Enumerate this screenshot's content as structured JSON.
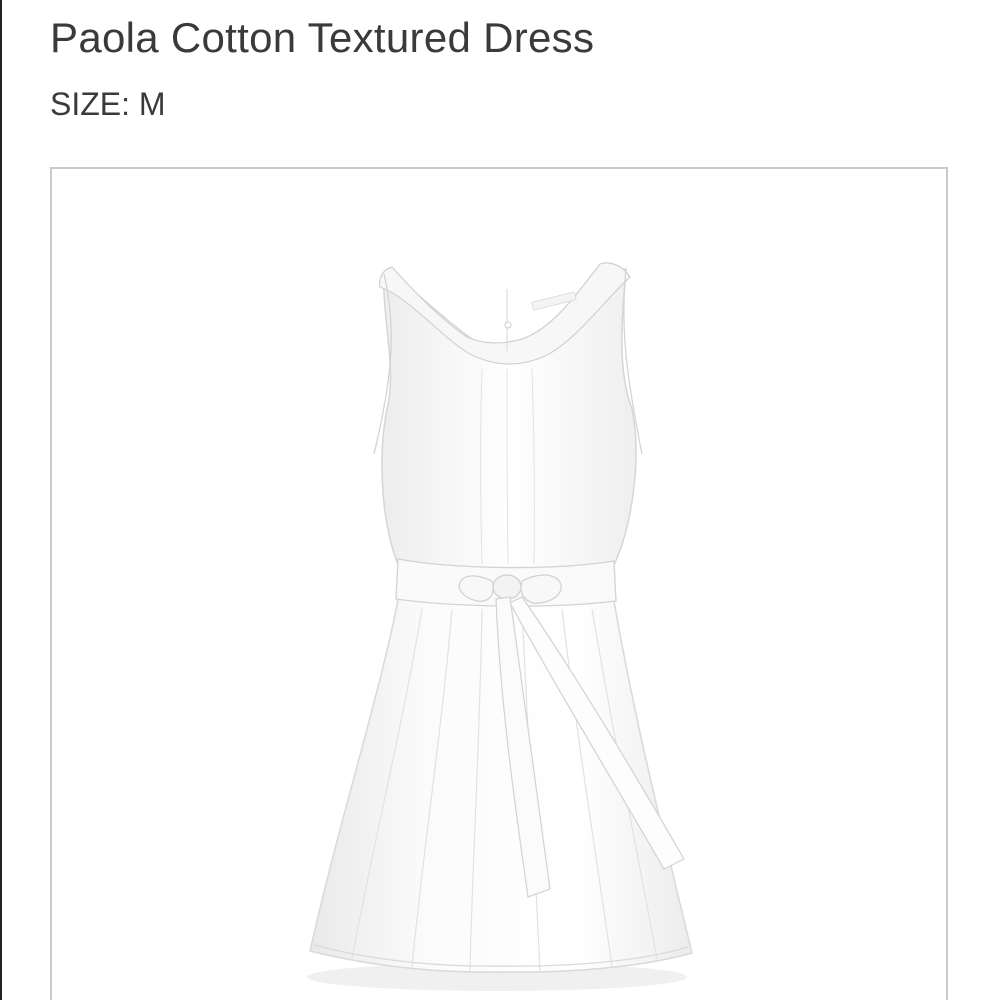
{
  "product": {
    "title": "Paola Cotton Textured Dress",
    "size_label": "SIZE:",
    "size_value": "M"
  },
  "image": {
    "subject": "white-sleeveless-dress-with-tie-belt",
    "frame_border_color": "#c9c9c9",
    "fabric_color": "#ffffff",
    "shadow_color": "#e6e6e6"
  },
  "colors": {
    "text": "#3a3a3a",
    "background": "#ffffff"
  }
}
